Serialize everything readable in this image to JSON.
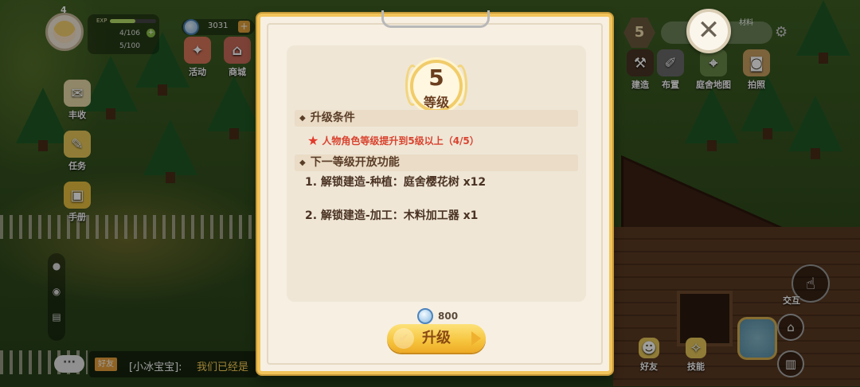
{
  "hud": {
    "player_level": "4",
    "exp_label": "EXP",
    "exp_fraction": 0.55,
    "energy": "4/106",
    "capacity": "5/100",
    "coins": "3031",
    "buttons": {
      "activity": "活动",
      "shop": "商城",
      "harvest": "丰收",
      "task": "任务",
      "handbook": "手册"
    }
  },
  "right_hud": {
    "level": "5",
    "material_label": "材料",
    "buttons": {
      "build": "建造",
      "decorate": "布置",
      "map": "庭舍地图",
      "photo": "拍照",
      "interact": "交互",
      "friends": "好友",
      "skills": "技能"
    }
  },
  "chat": {
    "button": "···",
    "tag": "好友",
    "name": "[小冰宝宝]:",
    "message": "我们已经是"
  },
  "dialog": {
    "level_number": "5",
    "level_text": "等级",
    "condition_title": "升级条件",
    "condition_text": "人物角色等级提升到5级以上（4/5）",
    "features_title": "下一等级开放功能",
    "features": [
      "1. 解锁建造-种植：庭舍樱花树 x12",
      "2. 解锁建造-加工：木料加工器 x1"
    ],
    "cost": "800",
    "upgrade_label": "升级"
  },
  "colors": {
    "accent_gold": "#f2c45a",
    "condition_red": "#d9432f",
    "dialog_bg": "#f6efe2"
  },
  "icons": [
    "close-icon",
    "star-icon",
    "gem-icon",
    "check-icon",
    "settings-icon"
  ]
}
